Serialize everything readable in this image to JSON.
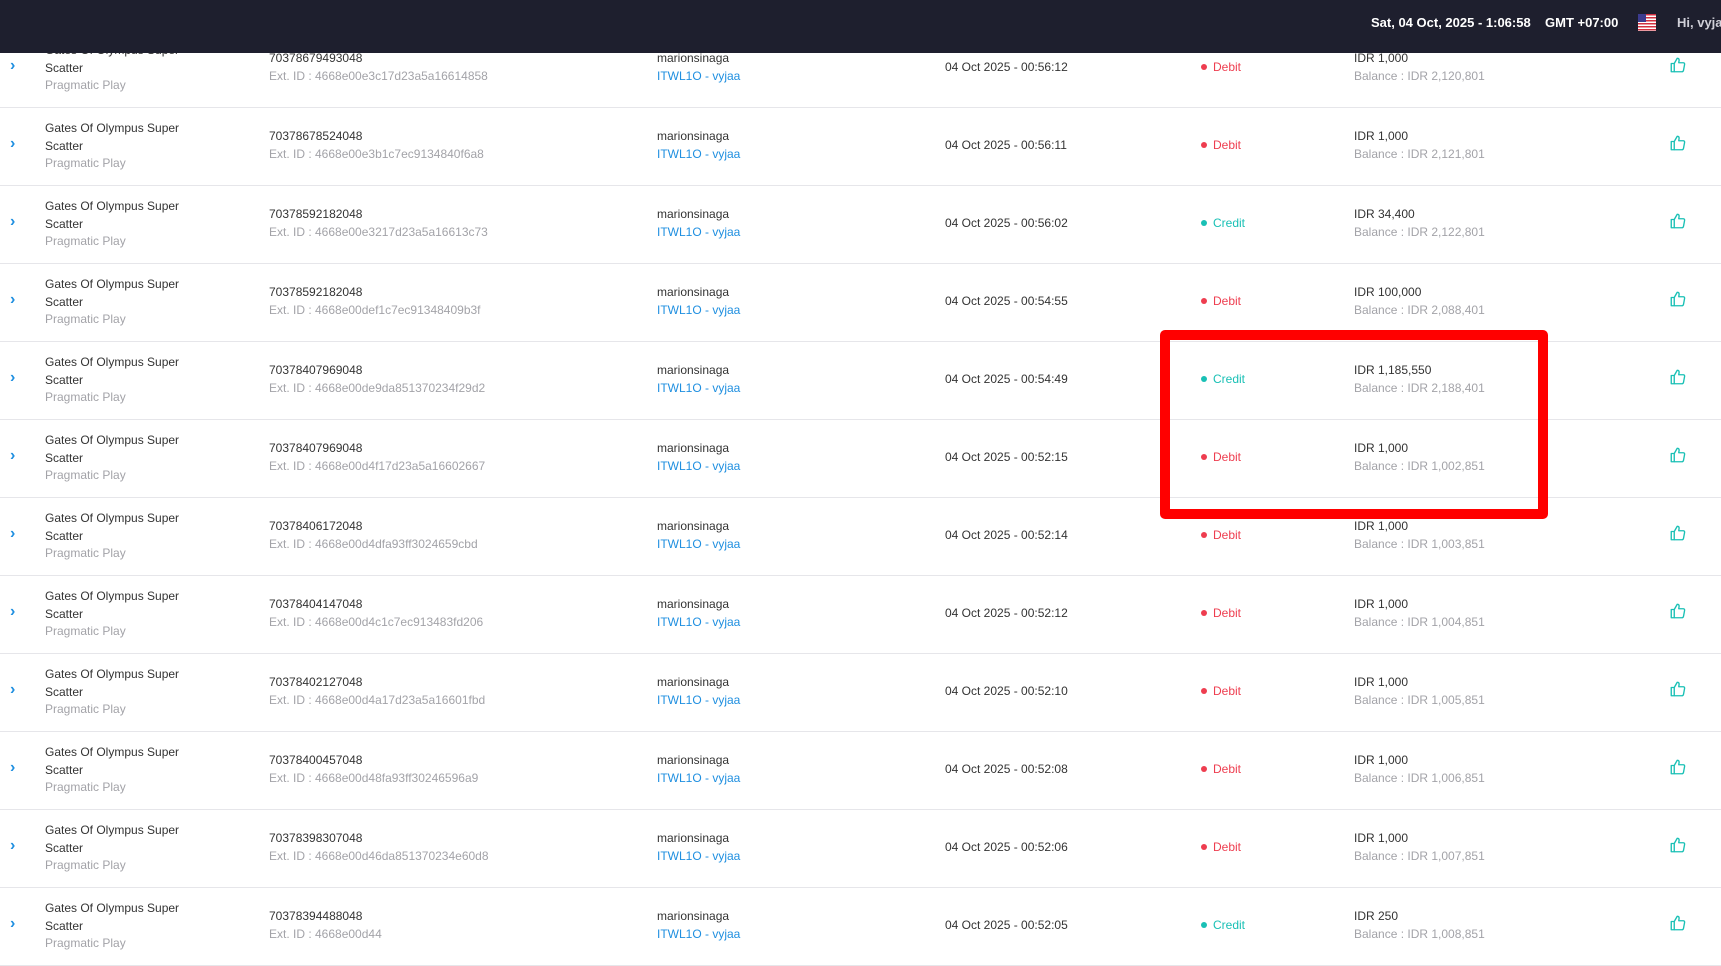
{
  "header": {
    "datetime": "Sat, 04 Oct, 2025 - 1:06:58",
    "timezone": "GMT +07:00",
    "greeting": "Hi, vyjaa"
  },
  "rows": [
    {
      "game": "Gates Of Olympus Super Scatter",
      "provider": "Pragmatic Play",
      "tx_id": "70378679493048",
      "ext_id": "Ext. ID : 4668e00e3c17d23a5a16614858",
      "username": "marionsinaga",
      "agent": "ITWL1O - vyjaa",
      "date": "04 Oct 2025 - 00:56:12",
      "type": "Debit",
      "amount": "IDR 1,000",
      "balance": "Balance : IDR 2,120,801"
    },
    {
      "game": "Gates Of Olympus Super Scatter",
      "provider": "Pragmatic Play",
      "tx_id": "70378678524048",
      "ext_id": "Ext. ID : 4668e00e3b1c7ec9134840f6a8",
      "username": "marionsinaga",
      "agent": "ITWL1O - vyjaa",
      "date": "04 Oct 2025 - 00:56:11",
      "type": "Debit",
      "amount": "IDR 1,000",
      "balance": "Balance : IDR 2,121,801"
    },
    {
      "game": "Gates Of Olympus Super Scatter",
      "provider": "Pragmatic Play",
      "tx_id": "70378592182048",
      "ext_id": "Ext. ID : 4668e00e3217d23a5a16613c73",
      "username": "marionsinaga",
      "agent": "ITWL1O - vyjaa",
      "date": "04 Oct 2025 - 00:56:02",
      "type": "Credit",
      "amount": "IDR 34,400",
      "balance": "Balance : IDR 2,122,801"
    },
    {
      "game": "Gates Of Olympus Super Scatter",
      "provider": "Pragmatic Play",
      "tx_id": "70378592182048",
      "ext_id": "Ext. ID : 4668e00def1c7ec91348409b3f",
      "username": "marionsinaga",
      "agent": "ITWL1O - vyjaa",
      "date": "04 Oct 2025 - 00:54:55",
      "type": "Debit",
      "amount": "IDR 100,000",
      "balance": "Balance : IDR 2,088,401"
    },
    {
      "game": "Gates Of Olympus Super Scatter",
      "provider": "Pragmatic Play",
      "tx_id": "70378407969048",
      "ext_id": "Ext. ID : 4668e00de9da851370234f29d2",
      "username": "marionsinaga",
      "agent": "ITWL1O - vyjaa",
      "date": "04 Oct 2025 - 00:54:49",
      "type": "Credit",
      "amount": "IDR 1,185,550",
      "balance": "Balance : IDR 2,188,401"
    },
    {
      "game": "Gates Of Olympus Super Scatter",
      "provider": "Pragmatic Play",
      "tx_id": "70378407969048",
      "ext_id": "Ext. ID : 4668e00d4f17d23a5a16602667",
      "username": "marionsinaga",
      "agent": "ITWL1O - vyjaa",
      "date": "04 Oct 2025 - 00:52:15",
      "type": "Debit",
      "amount": "IDR 1,000",
      "balance": "Balance : IDR 1,002,851"
    },
    {
      "game": "Gates Of Olympus Super Scatter",
      "provider": "Pragmatic Play",
      "tx_id": "70378406172048",
      "ext_id": "Ext. ID : 4668e00d4dfa93ff3024659cbd",
      "username": "marionsinaga",
      "agent": "ITWL1O - vyjaa",
      "date": "04 Oct 2025 - 00:52:14",
      "type": "Debit",
      "amount": "IDR 1,000",
      "balance": "Balance : IDR 1,003,851"
    },
    {
      "game": "Gates Of Olympus Super Scatter",
      "provider": "Pragmatic Play",
      "tx_id": "70378404147048",
      "ext_id": "Ext. ID : 4668e00d4c1c7ec913483fd206",
      "username": "marionsinaga",
      "agent": "ITWL1O - vyjaa",
      "date": "04 Oct 2025 - 00:52:12",
      "type": "Debit",
      "amount": "IDR 1,000",
      "balance": "Balance : IDR 1,004,851"
    },
    {
      "game": "Gates Of Olympus Super Scatter",
      "provider": "Pragmatic Play",
      "tx_id": "70378402127048",
      "ext_id": "Ext. ID : 4668e00d4a17d23a5a16601fbd",
      "username": "marionsinaga",
      "agent": "ITWL1O - vyjaa",
      "date": "04 Oct 2025 - 00:52:10",
      "type": "Debit",
      "amount": "IDR 1,000",
      "balance": "Balance : IDR 1,005,851"
    },
    {
      "game": "Gates Of Olympus Super Scatter",
      "provider": "Pragmatic Play",
      "tx_id": "70378400457048",
      "ext_id": "Ext. ID : 4668e00d48fa93ff30246596a9",
      "username": "marionsinaga",
      "agent": "ITWL1O - vyjaa",
      "date": "04 Oct 2025 - 00:52:08",
      "type": "Debit",
      "amount": "IDR 1,000",
      "balance": "Balance : IDR 1,006,851"
    },
    {
      "game": "Gates Of Olympus Super Scatter",
      "provider": "Pragmatic Play",
      "tx_id": "70378398307048",
      "ext_id": "Ext. ID : 4668e00d46da851370234e60d8",
      "username": "marionsinaga",
      "agent": "ITWL1O - vyjaa",
      "date": "04 Oct 2025 - 00:52:06",
      "type": "Debit",
      "amount": "IDR 1,000",
      "balance": "Balance : IDR 1,007,851"
    },
    {
      "game": "Gates Of Olympus Super Scatter",
      "provider": "Pragmatic Play",
      "tx_id": "70378394488048",
      "ext_id": "Ext. ID : 4668e00d44",
      "username": "marionsinaga",
      "agent": "ITWL1O - vyjaa",
      "date": "04 Oct 2025 - 00:52:05",
      "type": "Credit",
      "amount": "IDR 250",
      "balance": "Balance : IDR 1,008,851"
    }
  ],
  "colors": {
    "topbar": "#1e1f2e",
    "debit": "#ee3d4f",
    "credit": "#19c0b5",
    "link": "#1f8fe0",
    "highlight": "#ff0000"
  },
  "icons": {
    "expand": "chevron-right-icon",
    "action": "thumbs-up-icon",
    "flag": "us-flag-icon"
  }
}
